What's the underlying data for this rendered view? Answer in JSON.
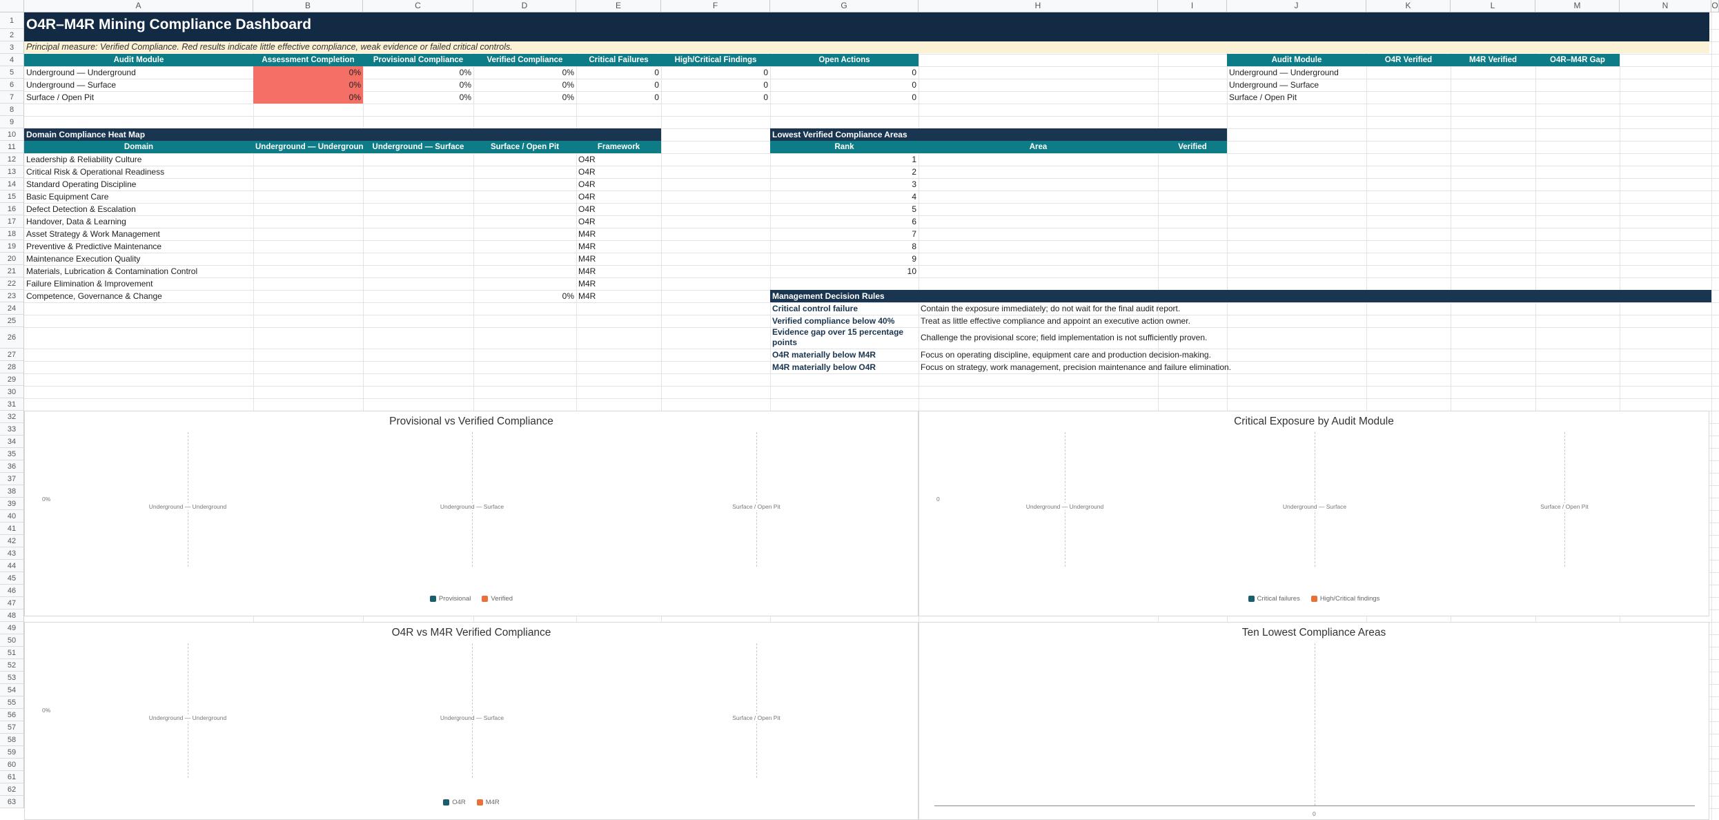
{
  "columns": [
    "A",
    "B",
    "C",
    "D",
    "E",
    "F",
    "G",
    "H",
    "I",
    "J",
    "K",
    "L",
    "M",
    "N",
    "O"
  ],
  "rows": [
    "1",
    "2",
    "3",
    "4",
    "5",
    "6",
    "7",
    "8",
    "9",
    "10",
    "11",
    "12",
    "13",
    "14",
    "15",
    "16",
    "17",
    "18",
    "19",
    "20",
    "21",
    "22",
    "23",
    "24",
    "25",
    "26",
    "27",
    "28",
    "29",
    "30",
    "31",
    "32",
    "33",
    "34",
    "35",
    "36",
    "37",
    "38",
    "39",
    "40",
    "41",
    "42",
    "43",
    "44",
    "45",
    "46",
    "47",
    "48",
    "49",
    "50",
    "51",
    "52",
    "53",
    "54",
    "55",
    "56",
    "57",
    "58",
    "59",
    "60",
    "61",
    "62",
    "63"
  ],
  "title": "O4R–M4R Mining Compliance Dashboard",
  "subtitle": "Principal measure: Verified Compliance. Red results indicate little effective compliance, weak evidence or failed critical controls.",
  "summary": {
    "headers": [
      "Audit Module",
      "Assessment Completion",
      "Provisional Compliance",
      "Verified Compliance",
      "Critical Failures",
      "High/Critical Findings",
      "Open Actions"
    ],
    "rows": [
      [
        "Underground — Underground",
        "0%",
        "0%",
        "0%",
        "0",
        "0",
        "0"
      ],
      [
        "Underground — Surface",
        "0%",
        "0%",
        "0%",
        "0",
        "0",
        "0"
      ],
      [
        "Surface / Open Pit",
        "0%",
        "0%",
        "0%",
        "0",
        "0",
        "0"
      ]
    ]
  },
  "framework_gap": {
    "headers": [
      "Audit Module",
      "O4R Verified",
      "M4R Verified",
      "O4R–M4R Gap"
    ],
    "rows": [
      "Underground — Underground",
      "Underground — Surface",
      "Surface / Open Pit"
    ]
  },
  "heatmap": {
    "title": "Domain Compliance Heat Map",
    "headers": [
      "Domain",
      "Underground — Underground",
      "Underground — Surface",
      "Surface / Open Pit",
      "Framework"
    ],
    "rows": [
      {
        "domain": "Leadership & Reliability Culture",
        "value": "",
        "framework": "O4R"
      },
      {
        "domain": "Critical Risk & Operational Readiness",
        "value": "",
        "framework": "O4R"
      },
      {
        "domain": "Standard Operating Discipline",
        "value": "",
        "framework": "O4R"
      },
      {
        "domain": "Basic Equipment Care",
        "value": "",
        "framework": "O4R"
      },
      {
        "domain": "Defect Detection & Escalation",
        "value": "",
        "framework": "O4R"
      },
      {
        "domain": "Handover, Data & Learning",
        "value": "",
        "framework": "O4R"
      },
      {
        "domain": "Asset Strategy & Work Management",
        "value": "",
        "framework": "M4R"
      },
      {
        "domain": "Preventive & Predictive Maintenance",
        "value": "",
        "framework": "M4R"
      },
      {
        "domain": "Maintenance Execution Quality",
        "value": "",
        "framework": "M4R"
      },
      {
        "domain": "Materials, Lubrication & Contamination Control",
        "value": "",
        "framework": "M4R"
      },
      {
        "domain": "Failure Elimination & Improvement",
        "value": "",
        "framework": "M4R"
      },
      {
        "domain": "Competence, Governance & Change",
        "value": "0%",
        "framework": "M4R"
      }
    ]
  },
  "lowest": {
    "title": "Lowest Verified Compliance Areas",
    "headers": [
      "Rank",
      "Area",
      "Verified"
    ],
    "ranks": [
      "1",
      "2",
      "3",
      "4",
      "5",
      "6",
      "7",
      "8",
      "9",
      "10"
    ]
  },
  "rules": {
    "title": "Management Decision Rules",
    "items": [
      {
        "rule": "Critical control failure",
        "action": "Contain the exposure immediately; do not wait for the final audit report."
      },
      {
        "rule": "Verified compliance below 40%",
        "action": "Treat as little effective compliance and appoint an executive action owner."
      },
      {
        "rule": "Evidence gap over 15 percentage points",
        "action": "Challenge the provisional score; field implementation is not sufficiently proven."
      },
      {
        "rule": "O4R materially below M4R",
        "action": "Focus on operating discipline, equipment care and production decision-making."
      },
      {
        "rule": "M4R materially below O4R",
        "action": "Focus on strategy, work management, precision maintenance and failure elimination."
      }
    ]
  },
  "charts": [
    {
      "title": "Provisional vs Verified Compliance",
      "categories": [
        "Underground — Underground",
        "Underground — Surface",
        "Surface / Open Pit"
      ],
      "axis_label": "0%",
      "legend": [
        "Provisional",
        "Verified"
      ],
      "colors": [
        "#1a5e6e",
        "#e8703a"
      ]
    },
    {
      "title": "Critical Exposure by Audit Module",
      "categories": [
        "Underground — Underground",
        "Underground — Surface",
        "Surface / Open Pit"
      ],
      "axis_label": "0",
      "legend": [
        "Critical failures",
        "High/Critical findings"
      ],
      "colors": [
        "#1a5e6e",
        "#e8703a"
      ]
    },
    {
      "title": "O4R vs M4R Verified Compliance",
      "categories": [
        "Underground — Underground",
        "Underground — Surface",
        "Surface / Open Pit"
      ],
      "axis_label": "0%",
      "legend": [
        "O4R",
        "M4R"
      ],
      "colors": [
        "#1a5e6e",
        "#e8703a"
      ]
    },
    {
      "title": "Ten Lowest Compliance Areas",
      "categories": [],
      "axis_label": "0",
      "legend": [],
      "colors": []
    }
  ],
  "colors": {
    "title_band": "#132a44",
    "header_teal": "#0e7c86",
    "section_navy": "#1a3550",
    "alert_red": "#f47066",
    "subtitle_band": "#fbf2d6"
  }
}
